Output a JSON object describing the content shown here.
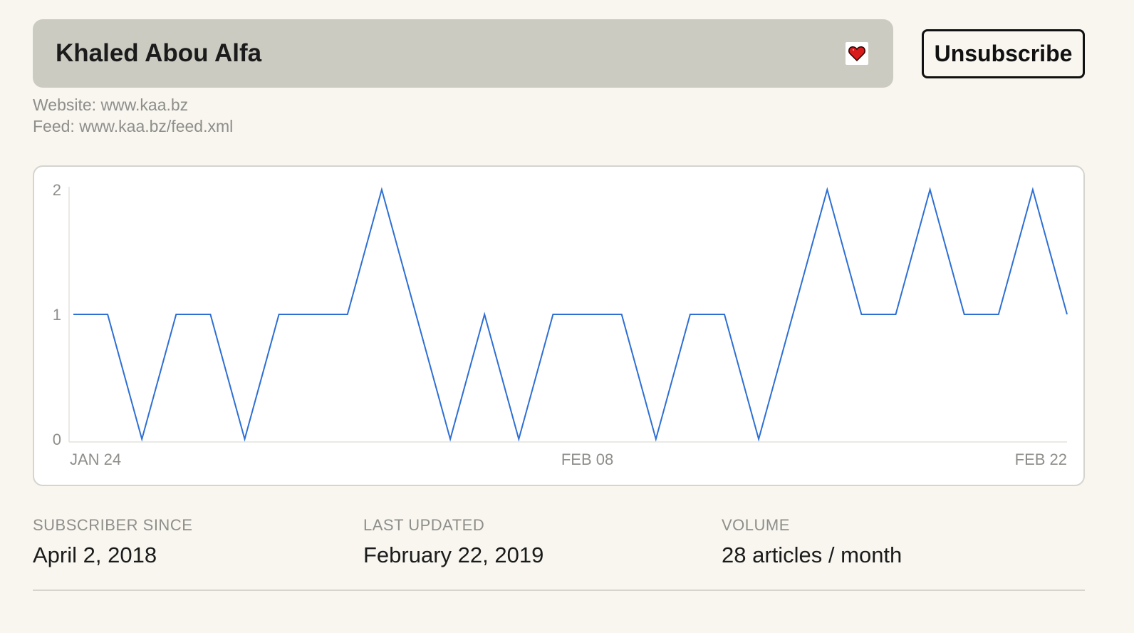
{
  "header": {
    "title": "Khaled Abou Alfa",
    "favorite_icon": "heart-icon",
    "unsubscribe_label": "Unsubscribe"
  },
  "meta": {
    "website": "Website: www.kaa.bz",
    "feed": "Feed: www.kaa.bz/feed.xml"
  },
  "chart_data": {
    "type": "line",
    "x_ticks": [
      "JAN 24",
      "FEB 08",
      "FEB 22"
    ],
    "y_ticks": [
      "0",
      "1",
      "2"
    ],
    "ylim": [
      0,
      2
    ],
    "x": [
      "JAN 24",
      "JAN 25",
      "JAN 26",
      "JAN 27",
      "JAN 28",
      "JAN 29",
      "JAN 30",
      "JAN 31",
      "FEB 01",
      "FEB 02",
      "FEB 03",
      "FEB 04",
      "FEB 05",
      "FEB 06",
      "FEB 07",
      "FEB 08",
      "FEB 09",
      "FEB 10",
      "FEB 11",
      "FEB 12",
      "FEB 13",
      "FEB 14",
      "FEB 15",
      "FEB 16",
      "FEB 17",
      "FEB 18",
      "FEB 19",
      "FEB 20",
      "FEB 21",
      "FEB 22"
    ],
    "values": [
      1,
      1,
      0,
      1,
      1,
      0,
      1,
      1,
      1,
      2,
      1,
      0,
      1,
      0,
      1,
      1,
      1,
      0,
      1,
      1,
      0,
      1,
      2,
      1,
      1,
      2,
      1,
      1,
      2,
      1
    ],
    "line_color": "#2e6fd3",
    "grid": false
  },
  "stats": [
    {
      "label": "SUBSCRIBER SINCE",
      "value": "April 2, 2018"
    },
    {
      "label": "LAST UPDATED",
      "value": "February 22, 2019"
    },
    {
      "label": "VOLUME",
      "value": "28 articles / month"
    }
  ]
}
